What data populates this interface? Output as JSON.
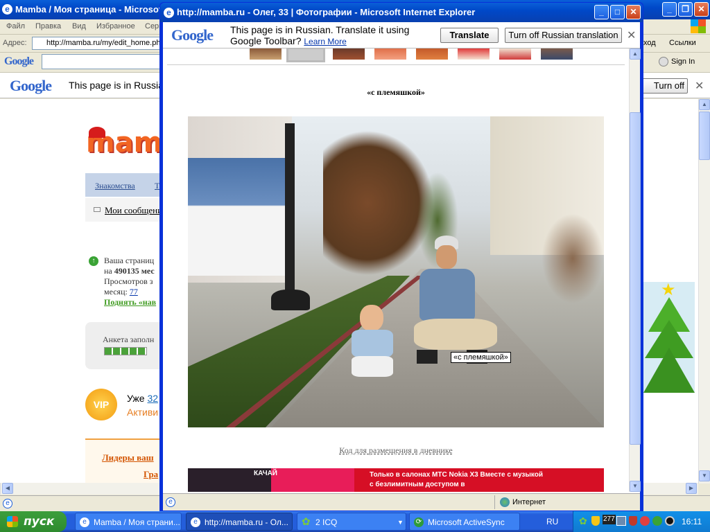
{
  "bg_window": {
    "title": "Mamba / Моя страница - Microsoft Internet Explorer",
    "menu": [
      "Файл",
      "Правка",
      "Вид",
      "Избранное",
      "Сервис"
    ],
    "address_label": "Адрес:",
    "address": "http://mamba.ru/my/edit_home.phtml",
    "right_menu": [
      "ход",
      "Ссылки"
    ],
    "signin": "Sign In",
    "google_msg": "This page is in Russian.",
    "translate_btn": "Turn off Russian translation",
    "logo_text": "mam",
    "nav_link1": "Знакомства",
    "nav_link2": "Т",
    "messages": "Мои сообщени",
    "stats_line1": "Ваша страниц",
    "stats_line2_prefix": "на ",
    "stats_num": "490135 мес",
    "stats_line3": "Просмотров з",
    "stats_line4_prefix": "месяц: ",
    "stats_month": "77",
    "raise_link": "Поднять «нав",
    "profile_fill": "Анкета заполн",
    "vip_badge": "VIP",
    "vip_text1": "Уже ",
    "vip_num": "32",
    "vip_text2": "Активи",
    "leaders": "Лидеры ваш",
    "leaders2": "Гра"
  },
  "popup": {
    "title": "http://mamba.ru - Олег, 33 | Фотографии - Microsoft Internet Explorer",
    "google_msg1": "This page is in Russian.  Translate it using",
    "google_msg2": "Google Toolbar?",
    "learn_more": "Learn More",
    "translate_btn": "Translate",
    "turnoff_btn": "Turn off Russian translation",
    "photo_caption": "«с племяшкой»",
    "photo_tooltip": "«с племяшкой»",
    "embed_link": "Код для размещения в дневнике",
    "banner_text1": "Только в салонах МТС Nokia X3 Вместе с музыкой",
    "banner_text2": "с безлимитным доступом в",
    "banner_left": "КАЧАЙ",
    "status_zone": "Интернет"
  },
  "taskbar": {
    "start": "пуск",
    "items": [
      "Mamba / Моя страни...",
      "http://mamba.ru - Ол...",
      "2 ICQ",
      "Microsoft ActiveSync"
    ],
    "lang": "RU",
    "tray_num": "277",
    "clock": "16:11"
  }
}
